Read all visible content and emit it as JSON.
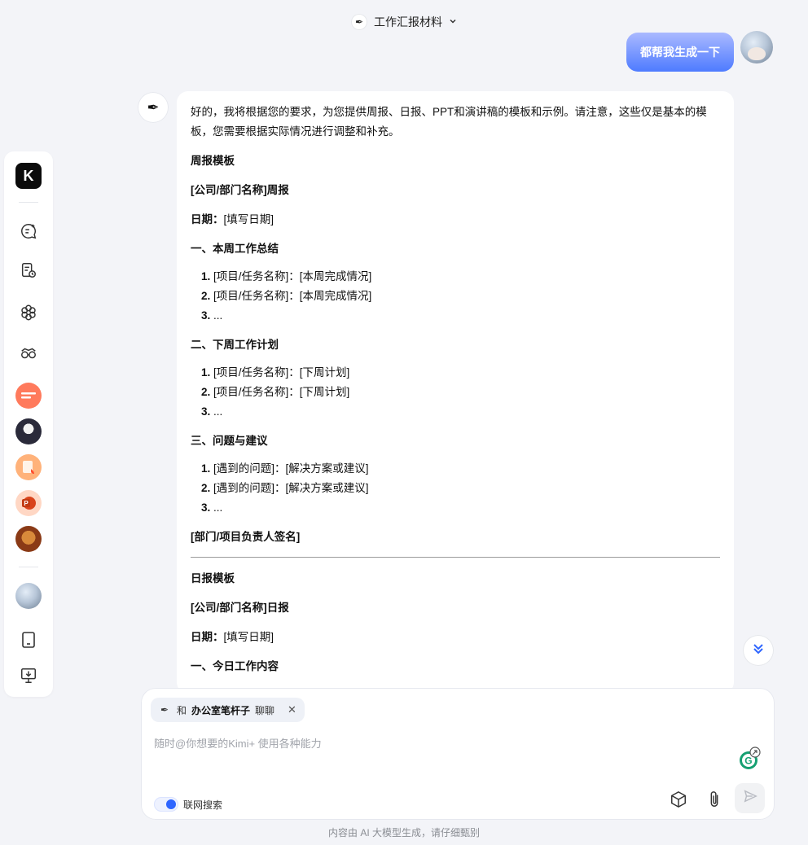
{
  "header": {
    "title": "工作汇报材料",
    "icon": "pen-icon"
  },
  "user_message": {
    "text": "都帮我生成一下"
  },
  "assistant": {
    "intro": "好的，我将根据您的要求，为您提供周报、日报、PPT和演讲稿的模板和示例。请注意，这些仅是基本的模板，您需要根据实际情况进行调整和补充。",
    "weekly": {
      "heading": "周报模板",
      "title": "[公司/部门名称]周报",
      "date_label": "日期：",
      "date_value": "[填写日期]",
      "sec1": "一、本周工作总结",
      "sec1_items": [
        "[项目/任务名称]：[本周完成情况]",
        "[项目/任务名称]：[本周完成情况]",
        "..."
      ],
      "sec2": "二、下周工作计划",
      "sec2_items": [
        "[项目/任务名称]：[下周计划]",
        "[项目/任务名称]：[下周计划]",
        "..."
      ],
      "sec3": "三、问题与建议",
      "sec3_items": [
        "[遇到的问题]：[解决方案或建议]",
        "[遇到的问题]：[解决方案或建议]",
        "..."
      ],
      "sign": "[部门/项目负责人签名]"
    },
    "daily": {
      "heading": "日报模板",
      "title": "[公司/部门名称]日报",
      "date_label": "日期：",
      "date_value": "[填写日期]",
      "sec1": "一、今日工作内容"
    }
  },
  "input": {
    "chip_prefix": "和",
    "chip_name": "办公室笔杆子",
    "chip_suffix": "聊聊",
    "placeholder": "随时@你想要的Kimi+ 使用各种能力",
    "web_search_label": "联网搜索",
    "web_search_on": true
  },
  "sidebar": {
    "logo": "K",
    "icons": [
      "new-chat-icon",
      "history-icon",
      "kimi-plus-icon",
      "explore-icon",
      "phone-icon",
      "download-icon"
    ]
  },
  "footer": "内容由 AI 大模型生成，请仔细甄别",
  "colors": {
    "accent": "#2f66ff",
    "user_bubble_top": "#aab9ff",
    "user_bubble_bottom": "#4e7bff"
  }
}
